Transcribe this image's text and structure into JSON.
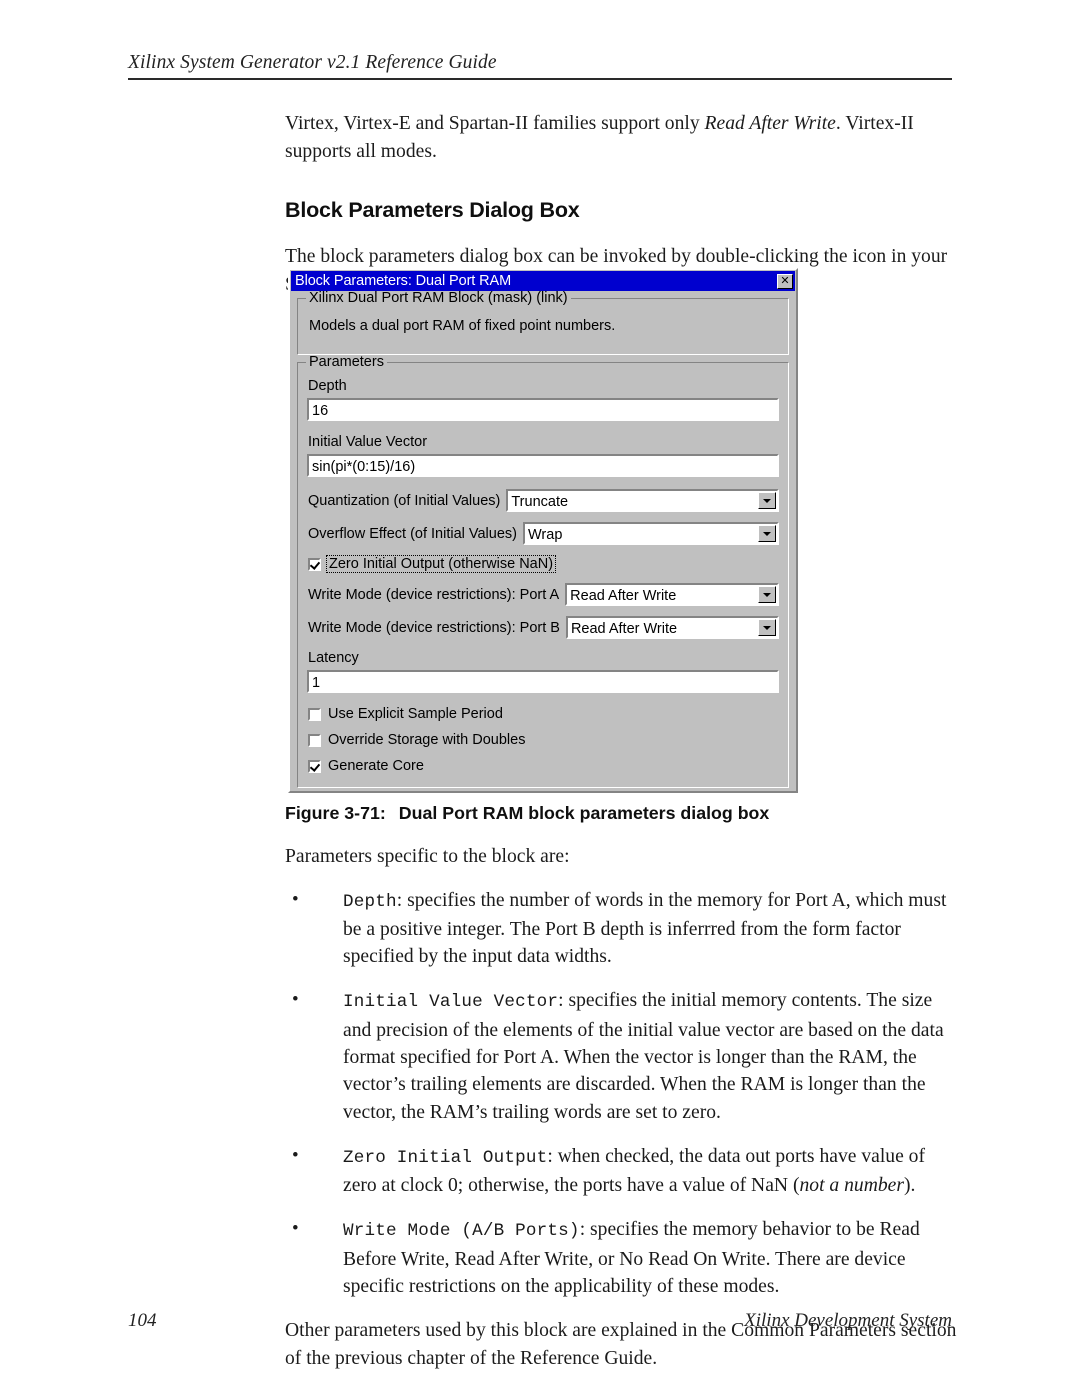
{
  "header": {
    "running_title": "Xilinx System Generator v2.1 Reference Guide"
  },
  "body": {
    "intro_p1_a": "Virtex, Virtex-E and Spartan-II families support only ",
    "intro_p1_em": "Read After Write",
    "intro_p1_b": ". Virtex-II supports all modes.",
    "section_title": "Block Parameters Dialog Box",
    "section_p1": "The block parameters dialog box can be invoked by double-clicking the icon in your Simulink model.",
    "figure_number": "Figure 3-71:",
    "figure_title": "Dual Port RAM block parameters dialog box",
    "list_intro": "Parameters specific to the block are:",
    "bullets": [
      {
        "code": "Depth",
        "text": ": specifies the number of words in the memory for Port A, which must be a positive integer. The Port B depth is inferrred from the form factor specified by the input data widths."
      },
      {
        "code": "Initial Value Vector",
        "text": ": specifies the initial memory contents. The size and precision of the elements of the initial value vector are based on the data format specified for Port A. When the vector is longer than the RAM, the vector’s trailing elements are discarded. When the RAM is longer than the vector, the RAM’s trailing words are set to zero."
      },
      {
        "code": "Zero Initial Output",
        "text_a": ": when checked, the data out ports have value of zero at clock 0; otherwise, the ports have a value of NaN (",
        "text_em": "not a number",
        "text_b": ")."
      },
      {
        "code": "Write Mode (A/B Ports)",
        "text": ": specifies the memory behavior to be Read Before Write, Read After Write, or No Read On Write. There are device specific restrictions on the applicability of these modes."
      }
    ],
    "closing_p": "Other parameters used by this block are explained in the Common Parameters section of the previous chapter of the Reference Guide."
  },
  "footer": {
    "page_number": "104",
    "system_name": "Xilinx Development System"
  },
  "dialog": {
    "titlebar": {
      "title": "Block Parameters: Dual Port RAM",
      "close_glyph": "✕",
      "bg_color": "#0000cf",
      "text_color": "#ffffff"
    },
    "mask_group": {
      "legend": "Xilinx Dual Port RAM Block (mask) (link)",
      "description": "Models a dual port RAM of fixed point numbers."
    },
    "params_group": {
      "legend": "Parameters",
      "depth": {
        "label": "Depth",
        "value": "16"
      },
      "initial_value_vector": {
        "label": "Initial Value Vector",
        "value": "sin(pi*(0:15)/16)"
      },
      "quantization": {
        "label": "Quantization (of Initial Values)",
        "value": "Truncate"
      },
      "overflow": {
        "label": "Overflow Effect (of Initial Values)",
        "value": "Wrap"
      },
      "zero_initial_output": {
        "label": "Zero Initial Output  (otherwise NaN)",
        "checked": true
      },
      "write_mode_a": {
        "label": "Write Mode (device restrictions):  Port A",
        "value": "Read After Write"
      },
      "write_mode_b": {
        "label": "Write Mode (device restrictions):  Port B",
        "value": "Read After Write"
      },
      "latency": {
        "label": "Latency",
        "value": "1"
      },
      "use_explicit_sample_period": {
        "label": "Use Explicit Sample Period",
        "checked": false
      },
      "override_storage_with_doubles": {
        "label": "Override Storage with Doubles",
        "checked": false
      },
      "generate_core": {
        "label": "Generate Core",
        "checked": true
      }
    }
  }
}
